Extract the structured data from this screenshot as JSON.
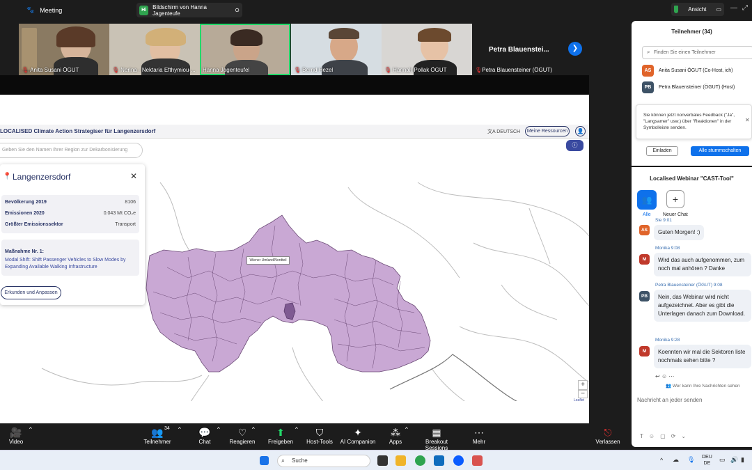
{
  "topbar": {
    "app": "Meeting",
    "share_label": "Bildschirm von Hanna Jagenteufe",
    "share_icon": "Hi",
    "view": "Ansicht"
  },
  "participants_strip": [
    {
      "name": "Anita Susani ÖGUT",
      "muted": true
    },
    {
      "name": "Nerina - Nektaria Efthymiou-...",
      "muted": true
    },
    {
      "name": "Hanna Jagenteufel",
      "muted": false,
      "active": true
    },
    {
      "name": "Bernd Hezel",
      "muted": true
    },
    {
      "name": "Hannah Pollak ÖGUT",
      "muted": true
    }
  ],
  "featured": {
    "big_name": "Petra  Blauenstei...",
    "name": "Petra Blauensteiner (ÖGUT)"
  },
  "app": {
    "title": "LOCALISED Climate Action Strategiser für Langenzersdorf",
    "language": "DEUTSCH",
    "resources": "Meine Ressourcen",
    "search_placeholder": "Geben Sie den Namen Ihrer Region zur Dekarbonisierung",
    "info": "ⓘ",
    "tooltip": "Wiener Umland/Nordteil",
    "leaflet": "Leaflet",
    "panel": {
      "title": "Langenzersdorf",
      "stats": [
        {
          "label": "Bevölkerung 2019",
          "value": "8106"
        },
        {
          "label": "Emissionen 2020",
          "value": "0.043 Mt CO₂e"
        },
        {
          "label": "Größter Emissionssektor",
          "value": "Transport"
        }
      ],
      "measure_title": "Maßnahme Nr. 1:",
      "measure_text": "Modal Shift: Shift Passenger Vehicles to Slow Modes by Expanding Available Walking Infrastructure",
      "explore": "Erkunden und Anpassen"
    }
  },
  "toolbar": {
    "video": "Video",
    "participants": "Teilnehmer",
    "participants_count": "34",
    "chat": "Chat",
    "react": "Reagieren",
    "share": "Freigeben",
    "host_tools": "Host-Tools",
    "ai": "AI Companion",
    "apps": "Apps",
    "breakout": "Breakout Sessions",
    "more": "Mehr",
    "leave": "Verlassen"
  },
  "panel": {
    "title": "Teilnehmer (34)",
    "search": "Finden Sie einen Teilnehmer",
    "people": [
      {
        "initials": "AS",
        "name": "Anita Susani ÖGUT (Co-Host, ich)",
        "color": "#e0642a"
      },
      {
        "initials": "PB",
        "name": "Petra Blauensteiner (ÖGUT) (Host)",
        "color": "#3d5266"
      }
    ],
    "feedback": "Sie können jetzt nonverbales Feedback (\"Ja\", \"Langsamer\" usw.) über \"Reaktionen\" in der Symbolleiste senden.",
    "invite": "Einladen",
    "mute_all": "Alle stummschalten"
  },
  "chat": {
    "title": "Localised Webinar \"CAST-Tool\"",
    "all": "Alle",
    "new_chat": "Neuer Chat",
    "messages": [
      {
        "sender": "Sie 9:01",
        "initials": "AS",
        "color": "#e0642a",
        "text": "Guten Morgen! :)"
      },
      {
        "sender": "Monika 9:08",
        "initials": "M",
        "color": "#c0392b",
        "text": "Wird das auch aufgenommen, zum noch mal anhören ? Danke"
      },
      {
        "sender": "Petra Blauensteiner (ÖGUT) 9:08",
        "initials": "PB",
        "color": "#3d5266",
        "text": "Nein, das Webinar wird nicht aufgezeichnet. Aber es gibt die Unterlagen danach zum Download."
      },
      {
        "sender": "Monika 9:28",
        "initials": "M",
        "color": "#c0392b",
        "text": "Koennten wir mal die Sektoren liste nochmals sehen bitte ?"
      }
    ],
    "who_can_see": "Wer kann Ihre Nachrichten sehen",
    "input_placeholder": "Nachricht an jeder senden"
  },
  "taskbar": {
    "search": "Suche",
    "lang": "DEU",
    "region": "DE"
  }
}
